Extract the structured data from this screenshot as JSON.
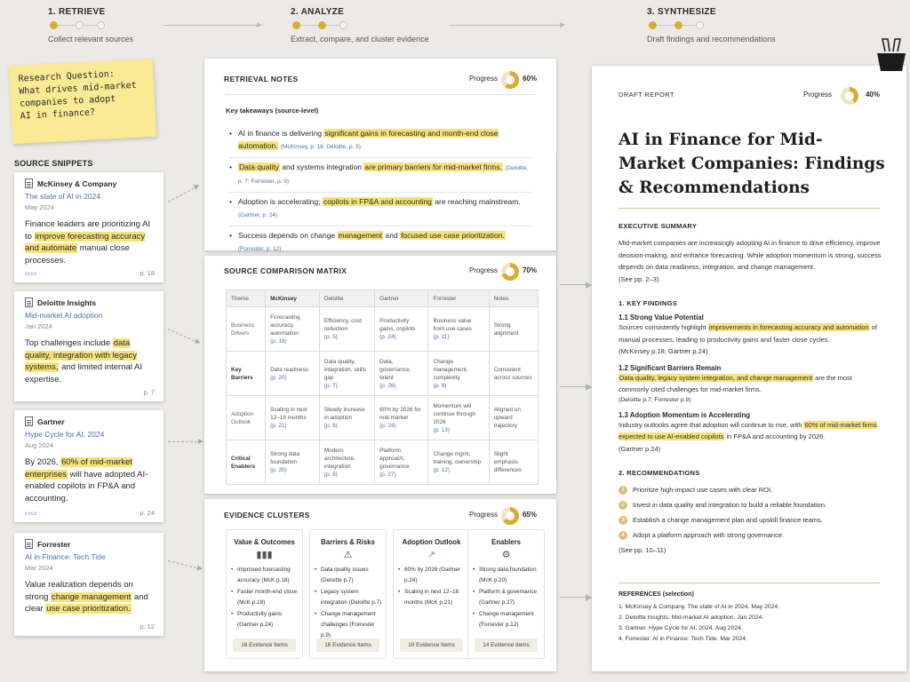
{
  "steps": [
    {
      "title": "1. RETRIEVE",
      "desc": "Collect relevant sources"
    },
    {
      "title": "2. ANALYZE",
      "desc": "Extract, compare, and cluster evidence"
    },
    {
      "title": "3. SYNTHESIZE",
      "desc": "Draft findings and recommendations"
    }
  ],
  "research_note": {
    "lines": [
      "Research Question:",
      "What drives mid-market",
      "companies to adopt",
      "AI in finance?"
    ]
  },
  "sources_label": "SOURCE SNIPPETS",
  "snippets": [
    {
      "source": "McKinsey & Company",
      "title": "The state of AI in 2024",
      "date": "May 2024",
      "t1": "Finance leaders are prioritizing AI to ",
      "h1": "improve forecasting accuracy and automate",
      "t2": " manual close processes.",
      "h2": "",
      "t3": "",
      "page": "p. 18"
    },
    {
      "source": "Deloitte Insights",
      "title": "Mid-market AI adoption",
      "date": "Jan 2024",
      "t1": "Top challenges include ",
      "h1": "data quality, integration with legacy systems,",
      "t2": " and limited internal AI expertise.",
      "h2": "",
      "t3": "",
      "page": "p. 7"
    },
    {
      "source": "Gartner",
      "title": "Hype Cycle for AI, 2024",
      "date": "Aug 2024",
      "t1": "By 2026, ",
      "h1": "60% of mid-market enterprises",
      "t2": " will have adopted AI-enabled copilots in FP&A and accounting.",
      "h2": "",
      "t3": "",
      "page": "p. 24"
    },
    {
      "source": "Forrester",
      "title": "AI in Finance: Tech Tide",
      "date": "Mar 2024",
      "t1": "Value realization depends on strong ",
      "h1": "change management",
      "t2": " and clear ",
      "h2": "use case prioritization.",
      "t3": "",
      "page": "p. 12"
    }
  ],
  "retrieval": {
    "title": "RETRIEVAL NOTES",
    "progress_label": "Progress",
    "progress": "60%",
    "progress_value": 60,
    "key_label": "Key takeaways (source-level)",
    "items": [
      {
        "t1": "AI in finance is delivering ",
        "h1": "significant gains in forecasting and month-end close automation.",
        "t2": "",
        "h2": "",
        "t3": "",
        "cite": "(McKinsey, p. 18; Deloitte, p. 5)"
      },
      {
        "t1": "",
        "h1": "Data quality",
        "t2": " and systems integration ",
        "h2": "are primary barriers for mid-market firms.",
        "t3": "",
        "cite": "(Deloitte, p. 7; Forrester, p. 9)"
      },
      {
        "t1": "Adoption is accelerating; ",
        "h1": "copilots in FP&A and accounting",
        "t2": " are reaching mainstream.",
        "h2": "",
        "t3": "",
        "cite": "(Gartner, p. 24)"
      },
      {
        "t1": "Success depends on change ",
        "h1": "management",
        "t2": " and ",
        "h2": "focused use case prioritization.",
        "t3": "",
        "cite": "(Forrester, p. 12)"
      }
    ]
  },
  "matrix": {
    "title": "SOURCE COMPARISON MATRIX",
    "progress_label": "Progress",
    "progress": "70%",
    "progress_value": 70,
    "headers": [
      "Theme",
      "McKinsey",
      "Deloitte",
      "Gartner",
      "Forrester",
      "Notes"
    ],
    "rows": [
      {
        "theme": "Business Drivers",
        "c1": "Forecasting accuracy, automation",
        "p1": "(p. 18)",
        "c2": "Efficiency, cost reduction",
        "p2": "(p. 5)",
        "c3": "Productivity gains, copilots",
        "p3": "(p. 24)",
        "c4": "Business value from use cases",
        "p4": "(p. 11)",
        "note": "Strong alignment"
      },
      {
        "theme": "Key Barriers",
        "c1": "Data readiness",
        "p1": "(p. 20)",
        "c2": "Data quality, integration, skills gap",
        "p2": "(p. 7)",
        "c3": "Data, governance, talent",
        "p3": "(p. 26)",
        "c4": "Change management, complexity",
        "p4": "(p. 9)",
        "note": "Consistent across sources"
      },
      {
        "theme": "Adoption Outlook",
        "c1": "Scaling in next 12–18 months",
        "p1": "(p. 21)",
        "c2": "Steady increase in adoption",
        "p2": "(p. 6)",
        "c3": "60% by 2026 for mid-market",
        "p3": "(p. 24)",
        "c4": "Momentum will continue through 2026",
        "p4": "(p. 13)",
        "note": "Aligned on upward trajectory"
      },
      {
        "theme": "Critical Enablers",
        "c1": "Strong data foundation",
        "p1": "(p. 20)",
        "c2": "Modern architecture, integration",
        "p2": "(p. 8)",
        "c3": "Platform approach, governance",
        "p3": "(p. 27)",
        "c4": "Change mgmt, training, ownership",
        "p4": "(p. 12)",
        "note": "Slight emphasis differences"
      }
    ]
  },
  "clusters": {
    "title": "EVIDENCE CLUSTERS",
    "progress_label": "Progress",
    "progress": "65%",
    "progress_value": 65,
    "cols": [
      {
        "title": "Value & Outcomes",
        "icon": "bar-chart-icon",
        "glyph": "▮▮▮",
        "items": [
          "Improved forecasting accuracy (McK p.18)",
          "Faster month-end close (McK p.18)",
          "Productivity gains (Gartner p.24)"
        ],
        "count": "18 Evidence Items"
      },
      {
        "title": "Barriers & Risks",
        "icon": "warning-icon",
        "glyph": "⚠",
        "items": [
          "Data quality issues (Deloitte p.7)",
          "Legacy system integration (Deloitte p.7)",
          "Change management challenges (Forrester p.9)"
        ],
        "count": "16 Evidence Items"
      },
      {
        "title": "Adoption Outlook",
        "icon": "trend-up-icon",
        "glyph": "↗",
        "items": [
          "60% by 2026 (Gartner p.24)",
          "Scaling in next 12–18 months (McK p.21)"
        ],
        "count": "10 Evidence Items"
      },
      {
        "title": "Enablers",
        "icon": "gear-icon",
        "glyph": "⚙",
        "items": [
          "Strong data foundation (McK p.20)",
          "Platform & governance (Gartner p.27)",
          "Change management (Forrester p.12)"
        ],
        "count": "14 Evidence Items"
      }
    ]
  },
  "report": {
    "kind": "DRAFT REPORT",
    "progress_label": "Progress",
    "progress": "40%",
    "progress_value": 40,
    "title": "AI in Finance for Mid-Market Companies: Findings & Recommendations",
    "exec_title": "EXECUTIVE SUMMARY",
    "exec_text": "Mid-market companies are increasingly adopting AI in finance to drive efficiency, improve decision-making, and enhance forecasting. While adoption momentum is strong, success depends on data readiness, integration, and change management.",
    "exec_see": "(See pp. 2–3)",
    "kf_title": "1. KEY FINDINGS",
    "findings": [
      {
        "title": "1.1 Strong Value Potential",
        "t1": "Sources consistently highlight ",
        "h1": "improvements in forecasting accuracy and automation",
        "t2": " of manual processes, leading to productivity gains and faster close cycles.",
        "cite": "(McKinsey p.18; Gartner p.24)"
      },
      {
        "title": "1.2 Significant Barriers Remain",
        "t1": "",
        "h1": "Data quality, legacy system integration, and change management",
        "t2": " are the most commonly cited challenges for mid-market firms.",
        "cite": "(Deloitte p.7; Forrester p.9)"
      },
      {
        "title": "1.3 Adoption Momentum is Accelerating",
        "t1": "Industry outlooks agree that adoption will continue to rise, with ",
        "h1": "60% of mid-market firms expected to use AI-enabled copilots",
        "t2": " in FP&A and accounting by 2026.",
        "cite": "(Gartner p.24)"
      }
    ],
    "rec_title": "2. RECOMMENDATIONS",
    "recs": [
      {
        "n": "1",
        "text": "Prioritize high-impact use cases with clear ROI."
      },
      {
        "n": "2",
        "text": "Invest in data quality and integration to build a reliable foundation."
      },
      {
        "n": "3",
        "text": "Establish a change management plan and upskill finance teams."
      },
      {
        "n": "4",
        "text": "Adopt a platform approach with strong governance."
      }
    ],
    "rec_see": "(See pp. 10–11)",
    "ref_title": "REFERENCES (selection)",
    "refs": [
      "1. McKinsey & Company. The state of AI in 2024. May 2024.",
      "2. Deloitte Insights. Mid-market AI adoption. Jan 2024.",
      "3. Gartner. Hype Cycle for AI, 2024. Aug 2024.",
      "4. Forrester. AI in Finance: Tech Tide. Mar 2024."
    ]
  },
  "colors": {
    "accent": "#d6ad2f",
    "highlight": "#f8e27a",
    "link": "#4b6fa8"
  }
}
